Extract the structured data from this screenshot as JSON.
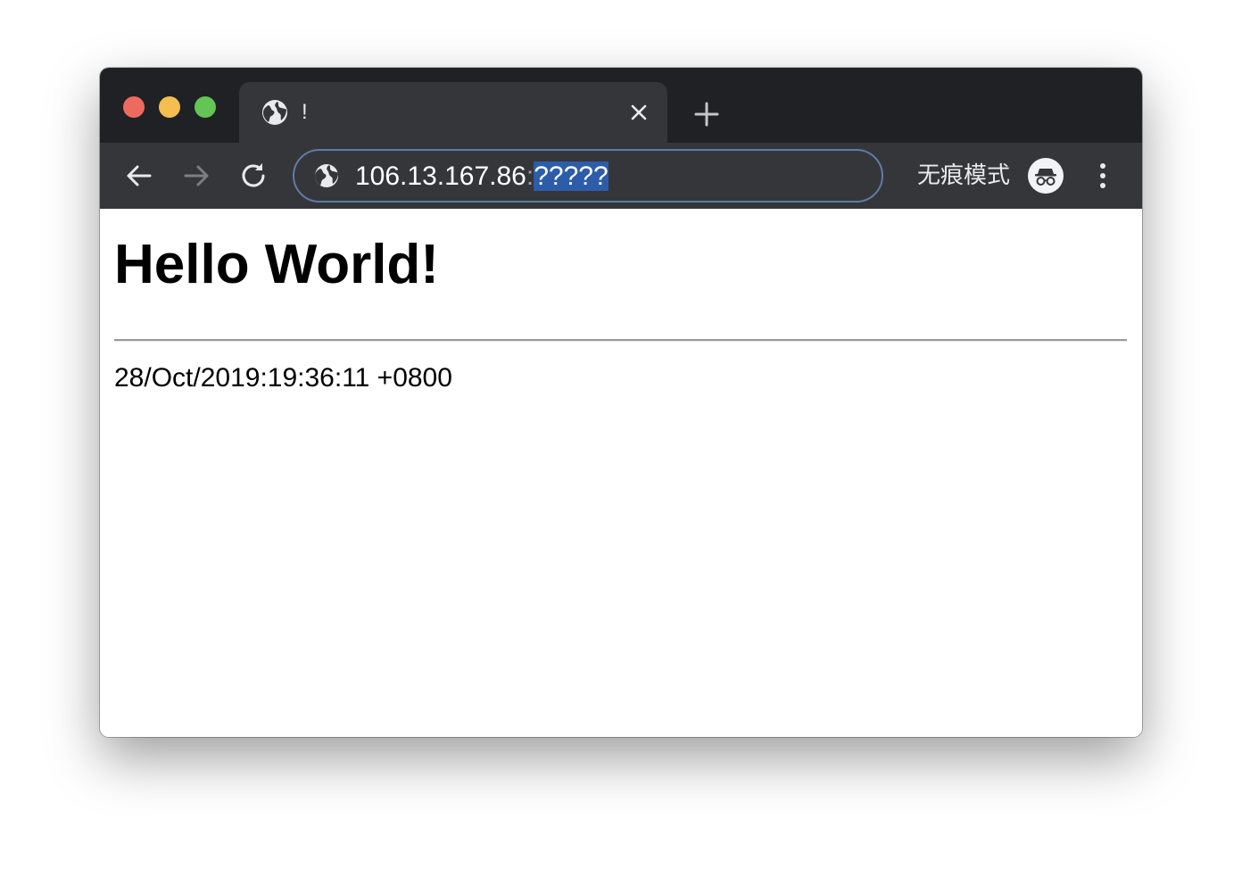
{
  "browser": {
    "tab": {
      "title": "!",
      "favicon": "globe-icon"
    },
    "address_bar": {
      "host": "106.13.167.86",
      "separator": ":",
      "port_selected": "?????"
    },
    "incognito": {
      "label": "无痕模式",
      "icon": "incognito-icon"
    },
    "icons": {
      "back": "arrow-left-icon",
      "forward": "arrow-right-icon",
      "reload": "reload-icon",
      "new_tab": "plus-icon",
      "close_tab": "close-icon",
      "menu": "kebab-menu-icon"
    },
    "colors": {
      "titlebar": "#202124",
      "toolbar": "#35363a",
      "selection": "#2d5ca8",
      "omnibox_border": "#5f7ba8",
      "traffic_close": "#ee6a5f",
      "traffic_minimize": "#f5be4f",
      "traffic_maximize": "#62c554"
    }
  },
  "page": {
    "heading": "Hello World!",
    "timestamp": "28/Oct/2019:19:36:11 +0800"
  }
}
